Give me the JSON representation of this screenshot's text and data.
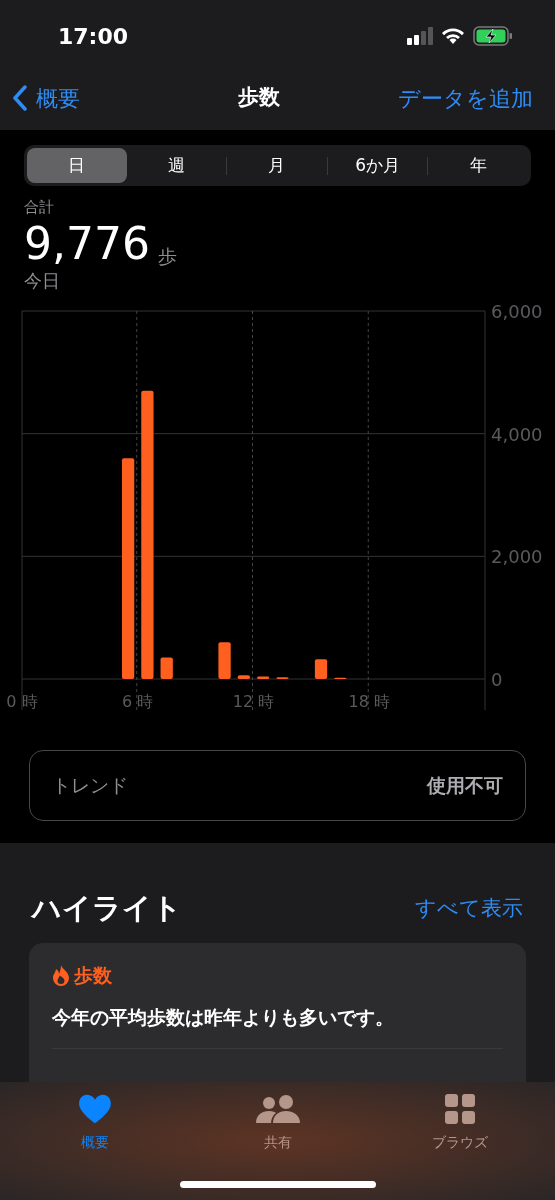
{
  "status_bar": {
    "time": "17:00"
  },
  "nav": {
    "back": "概要",
    "title": "歩数",
    "action": "データを追加"
  },
  "segments": [
    {
      "label": "日",
      "selected": true
    },
    {
      "label": "週",
      "selected": false
    },
    {
      "label": "月",
      "selected": false
    },
    {
      "label": "6か月",
      "selected": false
    },
    {
      "label": "年",
      "selected": false
    }
  ],
  "summary": {
    "label": "合計",
    "value": "9,776",
    "unit": "歩",
    "date": "今日"
  },
  "chart_data": {
    "type": "bar",
    "x": [
      5.5,
      6.5,
      7.5,
      10.5,
      11.5,
      12.5,
      13.5,
      15.5,
      16.5
    ],
    "grid": true,
    "xlim": [
      0,
      24
    ],
    "series": [
      {
        "color": "#ff5f1f",
        "values": [
          3600,
          4700,
          350,
          600,
          60,
          40,
          30,
          320,
          20
        ]
      }
    ],
    "ylim": [
      0,
      6000
    ],
    "yticks": [
      {
        "value": 0,
        "label": "0"
      },
      {
        "value": 2000,
        "label": "2,000"
      },
      {
        "value": 4000,
        "label": "4,000"
      },
      {
        "value": 6000,
        "label": "6,000"
      }
    ],
    "xticks": [
      {
        "value": 0,
        "label": "0 時"
      },
      {
        "value": 6,
        "label": "6 時"
      },
      {
        "value": 12,
        "label": "12 時"
      },
      {
        "value": 18,
        "label": "18 時"
      }
    ]
  },
  "trend": {
    "label": "トレンド",
    "value": "使用不可"
  },
  "highlights": {
    "title": "ハイライト",
    "link": "すべて表示",
    "card": {
      "category": "歩数",
      "text": "今年の平均歩数は昨年よりも多いです。"
    }
  },
  "tabs": [
    {
      "label": "概要",
      "kind": "heart",
      "selected": true
    },
    {
      "label": "共有",
      "kind": "people",
      "selected": false
    },
    {
      "label": "ブラウズ",
      "kind": "grid",
      "selected": false
    }
  ]
}
